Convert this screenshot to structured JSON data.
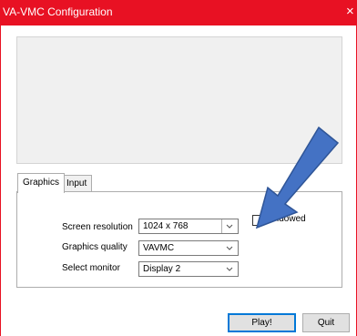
{
  "window": {
    "title": "VA-VMC Configuration",
    "close_glyph": "×",
    "accent_color": "#e81123"
  },
  "tabs": [
    {
      "label": "Graphics",
      "active": true
    },
    {
      "label": "Input",
      "active": false
    }
  ],
  "settings": {
    "resolution": {
      "label": "Screen resolution",
      "value": "1024 x 768"
    },
    "quality": {
      "label": "Graphics quality",
      "value": "VAVMC"
    },
    "monitor": {
      "label": "Select monitor",
      "value": "Display 2"
    },
    "windowed": {
      "label": "Windowed",
      "checked": false
    }
  },
  "buttons": {
    "play": "Play!",
    "quit": "Quit"
  },
  "annotation": {
    "icon": "arrow-icon",
    "color": "#4472c4"
  }
}
